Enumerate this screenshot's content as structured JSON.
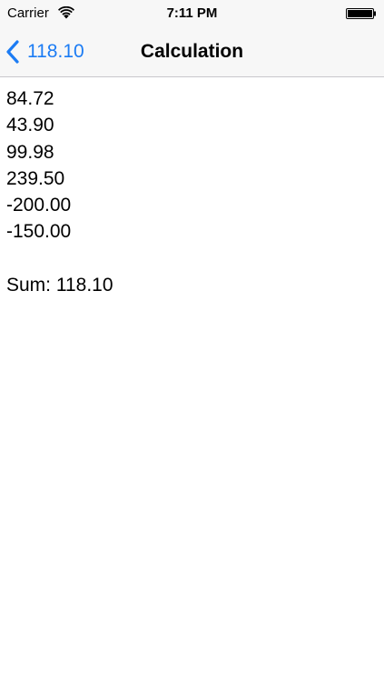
{
  "status_bar": {
    "carrier": "Carrier",
    "time": "7:11 PM",
    "icons": [
      "wifi-icon",
      "battery-icon"
    ]
  },
  "nav_bar": {
    "back_label": "118.10",
    "back_icon": "chevron-left-icon",
    "title": "Calculation",
    "accent_color": "#1c7cf4"
  },
  "content": {
    "values": [
      "84.72",
      "43.90",
      "99.98",
      "239.50",
      "-200.00",
      "-150.00"
    ],
    "sum": "Sum: 118.10"
  }
}
